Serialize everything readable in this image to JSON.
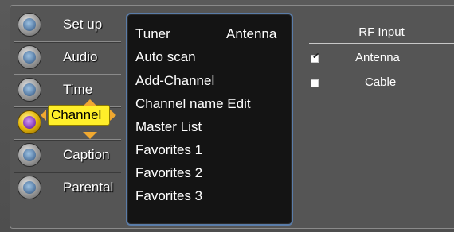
{
  "categories": [
    {
      "label": "Set up",
      "icon": "gears-icon"
    },
    {
      "label": "Audio",
      "icon": "speaker-icon"
    },
    {
      "label": "Time",
      "icon": "clock-icon"
    },
    {
      "label": "Channel",
      "icon": "satellite-dish-icon",
      "selected": true
    },
    {
      "label": "Caption",
      "icon": "caption-icon"
    },
    {
      "label": "Parental",
      "icon": "parental-lock-icon"
    }
  ],
  "submenu": {
    "items": [
      {
        "label": "Tuner",
        "value": "Antenna"
      },
      {
        "label": "Auto scan"
      },
      {
        "label": "Add-Channel"
      },
      {
        "label": "Channel name Edit"
      },
      {
        "label": "Master List"
      },
      {
        "label": "Favorites 1"
      },
      {
        "label": "Favorites 2"
      },
      {
        "label": "Favorites 3"
      }
    ]
  },
  "options": {
    "header": "RF Input",
    "choices": [
      {
        "label": "Antenna",
        "checked": true
      },
      {
        "label": "Cable",
        "checked": false
      }
    ]
  },
  "colors": {
    "highlight": "#ffef2a",
    "arrow": "#f0a830",
    "panel_border": "#5a7ca8"
  }
}
